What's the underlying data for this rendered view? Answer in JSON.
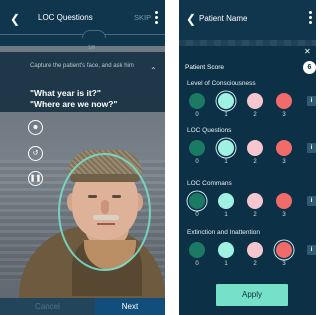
{
  "left_screen": {
    "title": "LOC Questions",
    "skip_label": "SKIP",
    "progress_label": "1/8",
    "instruction": "Capture the patient's face, and ask him",
    "question_1": "\"What year is it?\"",
    "question_2": "\"Where are we now?\"",
    "icons": [
      "face-scan-icon",
      "rotate-camera-icon",
      "pause-icon"
    ],
    "cancel_label": "Cancel",
    "next_label": "Next",
    "accent_color": "#124e7b"
  },
  "right_screen": {
    "title": "Patient Name",
    "score_label": "Patient Score",
    "score_value": "6",
    "sections": [
      {
        "title": "Level of Consciousness",
        "options": [
          "0",
          "1",
          "2",
          "3"
        ],
        "selected": "1"
      },
      {
        "title": "LOC Questions",
        "options": [
          "0",
          "1",
          "2",
          "3"
        ],
        "selected": "1"
      },
      {
        "title": "LOC Commans",
        "options": [
          "0",
          "1",
          "2",
          "3"
        ],
        "selected": "0"
      },
      {
        "title": "Extinction and Inattention",
        "options": [
          "0",
          "1",
          "2",
          "3"
        ],
        "selected": "3"
      }
    ],
    "option_colors": [
      "#1b7a64",
      "#9ff2e1",
      "#f6c6cf",
      "#f26b6b"
    ],
    "info_label": "i",
    "apply_label": "Apply"
  }
}
